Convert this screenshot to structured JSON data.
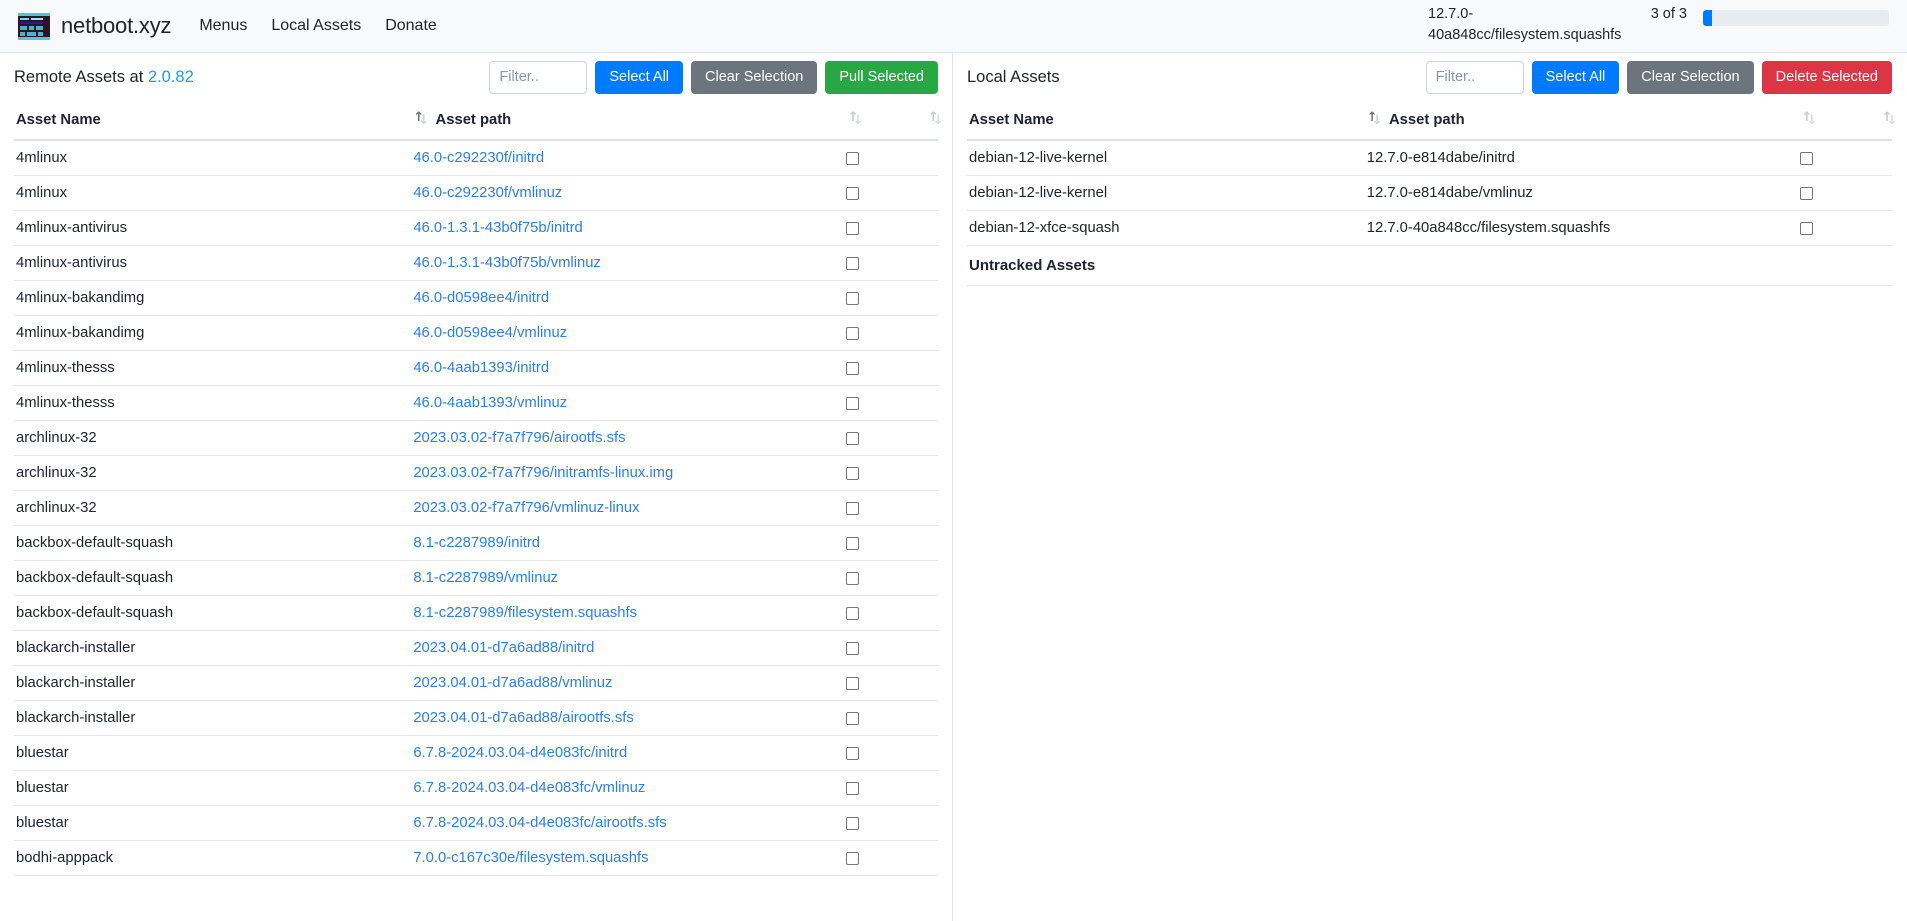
{
  "navbar": {
    "brand": "netboot.xyz",
    "logo_icon": "netboot-terminal-logo-icon",
    "links": [
      {
        "label": "Menus"
      },
      {
        "label": "Local Assets"
      },
      {
        "label": "Donate"
      }
    ],
    "download_status": {
      "filename": "12.7.0-40a848cc/filesystem.squashfs",
      "count": "3 of 3",
      "progress_percent": 5,
      "progress_color": "#007bff"
    }
  },
  "left_pane": {
    "title_prefix": "Remote Assets at ",
    "version": "2.0.82",
    "filter_placeholder": "Filter..",
    "filter_value": "",
    "buttons": {
      "select_all": "Select All",
      "clear_selection": "Clear Selection",
      "pull_selected": "Pull Selected"
    },
    "colors": {
      "select_all": "#007bff",
      "clear_selection": "#6c757d",
      "pull_selected": "#28a745",
      "link": "#2a7fe8"
    },
    "columns": [
      "Asset Name",
      "Asset path",
      ""
    ],
    "rows": [
      {
        "name": "4mlinux",
        "path": "46.0-c292230f/initrd"
      },
      {
        "name": "4mlinux",
        "path": "46.0-c292230f/vmlinuz"
      },
      {
        "name": "4mlinux-antivirus",
        "path": "46.0-1.3.1-43b0f75b/initrd"
      },
      {
        "name": "4mlinux-antivirus",
        "path": "46.0-1.3.1-43b0f75b/vmlinuz"
      },
      {
        "name": "4mlinux-bakandimg",
        "path": "46.0-d0598ee4/initrd"
      },
      {
        "name": "4mlinux-bakandimg",
        "path": "46.0-d0598ee4/vmlinuz"
      },
      {
        "name": "4mlinux-thesss",
        "path": "46.0-4aab1393/initrd"
      },
      {
        "name": "4mlinux-thesss",
        "path": "46.0-4aab1393/vmlinuz"
      },
      {
        "name": "archlinux-32",
        "path": "2023.03.02-f7a7f796/airootfs.sfs"
      },
      {
        "name": "archlinux-32",
        "path": "2023.03.02-f7a7f796/initramfs-linux.img"
      },
      {
        "name": "archlinux-32",
        "path": "2023.03.02-f7a7f796/vmlinuz-linux"
      },
      {
        "name": "backbox-default-squash",
        "path": "8.1-c2287989/initrd"
      },
      {
        "name": "backbox-default-squash",
        "path": "8.1-c2287989/vmlinuz"
      },
      {
        "name": "backbox-default-squash",
        "path": "8.1-c2287989/filesystem.squashfs"
      },
      {
        "name": "blackarch-installer",
        "path": "2023.04.01-d7a6ad88/initrd"
      },
      {
        "name": "blackarch-installer",
        "path": "2023.04.01-d7a6ad88/vmlinuz"
      },
      {
        "name": "blackarch-installer",
        "path": "2023.04.01-d7a6ad88/airootfs.sfs"
      },
      {
        "name": "bluestar",
        "path": "6.7.8-2024.03.04-d4e083fc/initrd"
      },
      {
        "name": "bluestar",
        "path": "6.7.8-2024.03.04-d4e083fc/vmlinuz"
      },
      {
        "name": "bluestar",
        "path": "6.7.8-2024.03.04-d4e083fc/airootfs.sfs"
      },
      {
        "name": "bodhi-apppack",
        "path": "7.0.0-c167c30e/filesystem.squashfs"
      }
    ]
  },
  "right_pane": {
    "title": "Local Assets",
    "filter_placeholder": "Filter..",
    "filter_value": "",
    "buttons": {
      "select_all": "Select All",
      "clear_selection": "Clear Selection",
      "delete_selected": "Delete Selected"
    },
    "colors": {
      "select_all": "#007bff",
      "clear_selection": "#6c757d",
      "delete_selected": "#dc3545"
    },
    "columns": [
      "Asset Name",
      "Asset path",
      ""
    ],
    "rows": [
      {
        "name": "debian-12-live-kernel",
        "path": "12.7.0-e814dabe/initrd"
      },
      {
        "name": "debian-12-live-kernel",
        "path": "12.7.0-e814dabe/vmlinuz"
      },
      {
        "name": "debian-12-xfce-squash",
        "path": "12.7.0-40a848cc/filesystem.squashfs"
      }
    ],
    "untracked_heading": "Untracked Assets",
    "untracked_rows": []
  }
}
